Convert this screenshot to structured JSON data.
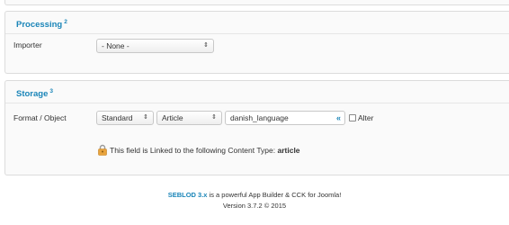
{
  "processing": {
    "title": "Processing",
    "title_sup": "2",
    "importer": {
      "label": "Importer",
      "value": "- None -"
    }
  },
  "storage": {
    "title": "Storage",
    "title_sup": "3",
    "format_label": "Format / Object",
    "storage_select": "Standard",
    "object_select": "Article",
    "field_name": "danish_language",
    "field_chevron": "«",
    "alter_label": "Alter",
    "alter_checked": false,
    "linked_notice": "This field is Linked to the following Content Type: ",
    "linked_type": "article"
  },
  "footer": {
    "brand": "SEBLOD 3.x",
    "tagline": " is a powerful App Builder & CCK for Joomla!",
    "version": "Version 3.7.2 © 2015"
  },
  "colors": {
    "accent": "#1a85b8",
    "lock": "#e8a33c"
  }
}
